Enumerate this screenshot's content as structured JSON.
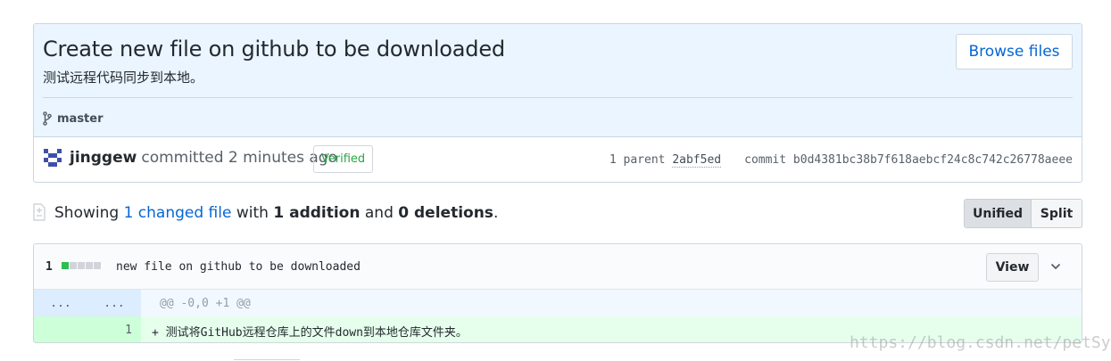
{
  "commit": {
    "title": "Create new file on github to be downloaded",
    "description": "测试远程代码同步到本地。",
    "browse_label": "Browse files",
    "branch": "master",
    "author": "jinggew",
    "committed_text": "committed 2 minutes ago",
    "verified_label": "Verified",
    "parent_prefix": "1 parent",
    "parent_sha": "2abf5ed",
    "commit_prefix": "commit",
    "commit_sha": "b0d4381bc38b7f618aebcf24c8c742c26778aeee"
  },
  "summary": {
    "showing": "Showing",
    "changed_files": "1 changed file",
    "with": "with",
    "additions": "1 addition",
    "and": "and",
    "deletions": "0 deletions",
    "period": "."
  },
  "view_toggle": {
    "unified": "Unified",
    "split": "Split",
    "selected": "Unified"
  },
  "file": {
    "change_count": "1",
    "name": "new file on github to be downloaded",
    "view_label": "View",
    "hunk_left": "...",
    "hunk_right": "...",
    "hunk_header": "@@ -0,0 +1 @@",
    "line_number": "1",
    "line_text": "+ 测试将GitHub远程仓库上的文件down到本地仓库文件夹。"
  },
  "watermark": "https://blog.csdn.net/petSym",
  "colors": {
    "link": "#0366d6",
    "verified": "#28a745",
    "addition_bg": "#e6ffed",
    "hunk_bg": "#f1f8ff",
    "commit_header_bg": "#eaf5ff"
  },
  "icons": [
    "git-branch-icon",
    "file-diff-icon",
    "chevron-down-icon"
  ]
}
